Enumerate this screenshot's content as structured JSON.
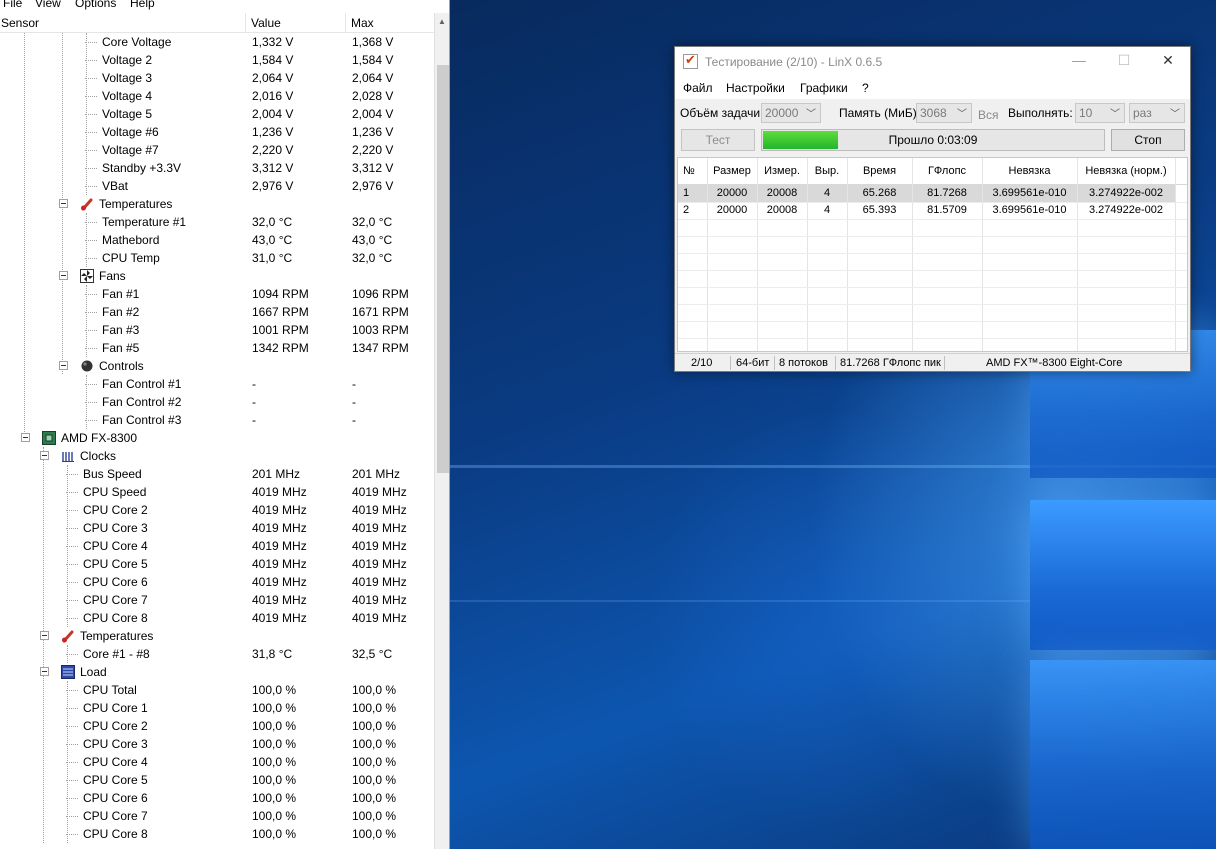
{
  "hwmonitor": {
    "menu": [
      "File",
      "View",
      "Options",
      "Help"
    ],
    "columns": {
      "sensor": "Sensor",
      "value": "Value",
      "max": "Max"
    },
    "rows": [
      {
        "label": "Core Voltage",
        "value": "1,332 V",
        "max": "1,368 V"
      },
      {
        "label": "Voltage 2",
        "value": "1,584 V",
        "max": "1,584 V"
      },
      {
        "label": "Voltage 3",
        "value": "2,064 V",
        "max": "2,064 V"
      },
      {
        "label": "Voltage 4",
        "value": "2,016 V",
        "max": "2,028 V"
      },
      {
        "label": "Voltage 5",
        "value": "2,004 V",
        "max": "2,004 V"
      },
      {
        "label": "Voltage #6",
        "value": "1,236 V",
        "max": "1,236 V"
      },
      {
        "label": "Voltage #7",
        "value": "2,220 V",
        "max": "2,220 V"
      },
      {
        "label": "Standby +3.3V",
        "value": "3,312 V",
        "max": "3,312 V"
      },
      {
        "label": "VBat",
        "value": "2,976 V",
        "max": "2,976 V"
      },
      {
        "label": "Temperatures",
        "value": "",
        "max": ""
      },
      {
        "label": "Temperature #1",
        "value": "32,0 °C",
        "max": "32,0 °C"
      },
      {
        "label": "Mathebord",
        "value": "43,0 °C",
        "max": "43,0 °C"
      },
      {
        "label": "CPU Temp",
        "value": "31,0 °C",
        "max": "32,0 °C"
      },
      {
        "label": "Fans",
        "value": "",
        "max": ""
      },
      {
        "label": "Fan #1",
        "value": "1094 RPM",
        "max": "1096 RPM"
      },
      {
        "label": "Fan #2",
        "value": "1667 RPM",
        "max": "1671 RPM"
      },
      {
        "label": "Fan #3",
        "value": "1001 RPM",
        "max": "1003 RPM"
      },
      {
        "label": "Fan #5",
        "value": "1342 RPM",
        "max": "1347 RPM"
      },
      {
        "label": "Controls",
        "value": "",
        "max": ""
      },
      {
        "label": "Fan Control #1",
        "value": "-",
        "max": "-"
      },
      {
        "label": "Fan Control #2",
        "value": "-",
        "max": "-"
      },
      {
        "label": "Fan Control #3",
        "value": "-",
        "max": "-"
      },
      {
        "label": "AMD FX-8300",
        "value": "",
        "max": ""
      },
      {
        "label": "Clocks",
        "value": "",
        "max": ""
      },
      {
        "label": "Bus Speed",
        "value": "201 MHz",
        "max": "201 MHz"
      },
      {
        "label": "CPU Speed",
        "value": "4019 MHz",
        "max": "4019 MHz"
      },
      {
        "label": "CPU Core 2",
        "value": "4019 MHz",
        "max": "4019 MHz"
      },
      {
        "label": "CPU Core 3",
        "value": "4019 MHz",
        "max": "4019 MHz"
      },
      {
        "label": "CPU Core 4",
        "value": "4019 MHz",
        "max": "4019 MHz"
      },
      {
        "label": "CPU Core 5",
        "value": "4019 MHz",
        "max": "4019 MHz"
      },
      {
        "label": "CPU Core 6",
        "value": "4019 MHz",
        "max": "4019 MHz"
      },
      {
        "label": "CPU Core 7",
        "value": "4019 MHz",
        "max": "4019 MHz"
      },
      {
        "label": "CPU Core 8",
        "value": "4019 MHz",
        "max": "4019 MHz"
      },
      {
        "label": "Temperatures",
        "value": "",
        "max": ""
      },
      {
        "label": "Core #1 - #8",
        "value": "31,8 °C",
        "max": "32,5 °C"
      },
      {
        "label": "Load",
        "value": "",
        "max": ""
      },
      {
        "label": "CPU Total",
        "value": "100,0 %",
        "max": "100,0 %"
      },
      {
        "label": "CPU Core 1",
        "value": "100,0 %",
        "max": "100,0 %"
      },
      {
        "label": "CPU Core 2",
        "value": "100,0 %",
        "max": "100,0 %"
      },
      {
        "label": "CPU Core 3",
        "value": "100,0 %",
        "max": "100,0 %"
      },
      {
        "label": "CPU Core 4",
        "value": "100,0 %",
        "max": "100,0 %"
      },
      {
        "label": "CPU Core 5",
        "value": "100,0 %",
        "max": "100,0 %"
      },
      {
        "label": "CPU Core 6",
        "value": "100,0 %",
        "max": "100,0 %"
      },
      {
        "label": "CPU Core 7",
        "value": "100,0 %",
        "max": "100,0 %"
      },
      {
        "label": "CPU Core 8",
        "value": "100,0 %",
        "max": "100,0 %"
      }
    ]
  },
  "linx": {
    "title": "Тестирование (2/10) - LinX 0.6.5",
    "menu": [
      "Файл",
      "Настройки",
      "Графики",
      "?"
    ],
    "problem_size_label": "Объём задачи:",
    "problem_size_value": "20000",
    "memory_label": "Память (МиБ):",
    "memory_value": "3068",
    "all_label": "Вся",
    "run_label": "Выполнять:",
    "run_value": "10",
    "run_unit": "раз",
    "test_button": "Тест",
    "stop_button": "Стоп",
    "progress_text": "Прошло 0:03:09",
    "progress_fraction": 0.22,
    "table": {
      "headers": [
        "№",
        "Размер",
        "Измер.",
        "Выр.",
        "Время",
        "ГФлопс",
        "Невязка",
        "Невязка (норм.)"
      ],
      "rows": [
        [
          "1",
          "20000",
          "20008",
          "4",
          "65.268",
          "81.7268",
          "3.699561e-010",
          "3.274922e-002"
        ],
        [
          "2",
          "20000",
          "20008",
          "4",
          "65.393",
          "81.5709",
          "3.699561e-010",
          "3.274922e-002"
        ]
      ]
    },
    "status": {
      "pass": "2/10",
      "bits": "64-бит",
      "threads": "8 потоков",
      "peak": "81.7268 ГФлопс пик",
      "cpu": "AMD FX™-8300 Eight-Core"
    }
  }
}
